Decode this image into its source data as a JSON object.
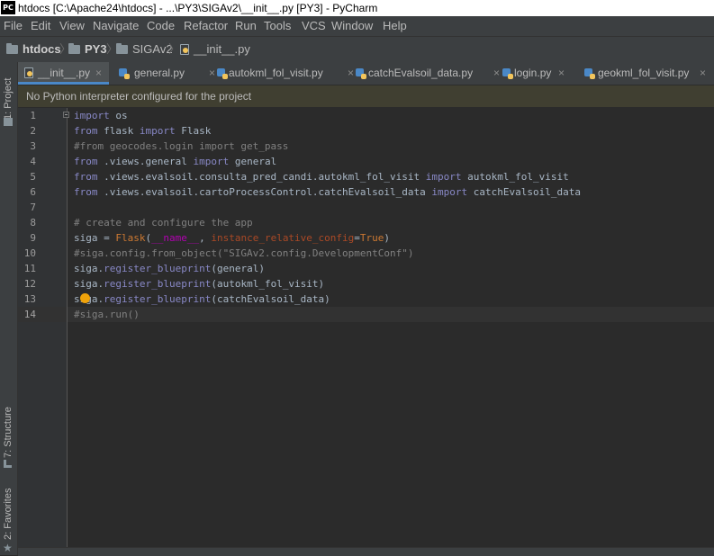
{
  "app": {
    "icon_label": "PC",
    "window_title": "htdocs [C:\\Apache24\\htdocs] - ...\\PY3\\SIGAv2\\__init__.py [PY3] - PyCharm"
  },
  "menu": [
    "File",
    "Edit",
    "View",
    "Navigate",
    "Code",
    "Refactor",
    "Run",
    "Tools",
    "VCS",
    "Window",
    "Help"
  ],
  "breadcrumb": [
    "htdocs",
    "PY3",
    "SIGAv2",
    "__init__.py"
  ],
  "side_tabs": {
    "project": "1: Project",
    "structure": "7: Structure",
    "favorites": "2: Favorites"
  },
  "tabs": [
    {
      "label": "__init__.py",
      "active": true
    },
    {
      "label": "general.py",
      "active": false
    },
    {
      "label": "autokml_fol_visit.py",
      "active": false
    },
    {
      "label": "catchEvalsoil_data.py",
      "active": false
    },
    {
      "label": "login.py",
      "active": false
    },
    {
      "label": "geokml_fol_visit.py",
      "active": false
    }
  ],
  "close_glyph": "×",
  "banner": "No Python interpreter configured for the project",
  "code_lines": [
    "import os",
    "from flask import Flask",
    "#from geocodes.login import get_pass",
    "from .views.general import general",
    "from .views.evalsoil.consulta_pred_candi.autokml_fol_visit import autokml_fol_visit",
    "from .views.evalsoil.cartoProcessControl.catchEvalsoil_data import catchEvalsoil_data",
    "",
    "# create and configure the app",
    "siga = Flask(__name__, instance_relative_config=True)",
    "#siga.config.from_object(\"SIGAv2.config.DevelopmentConf\")",
    "siga.register_blueprint(general)",
    "siga.register_blueprint(autokml_fol_visit)",
    "siga.register_blueprint(catchEvalsoil_data)",
    "#siga.run()"
  ],
  "current_line": 14,
  "colors": {
    "keyword": "#cc7832",
    "comment": "#808080",
    "string": "#6a8759",
    "accent": "#4a88c7",
    "warning_banner": "#403f31"
  }
}
